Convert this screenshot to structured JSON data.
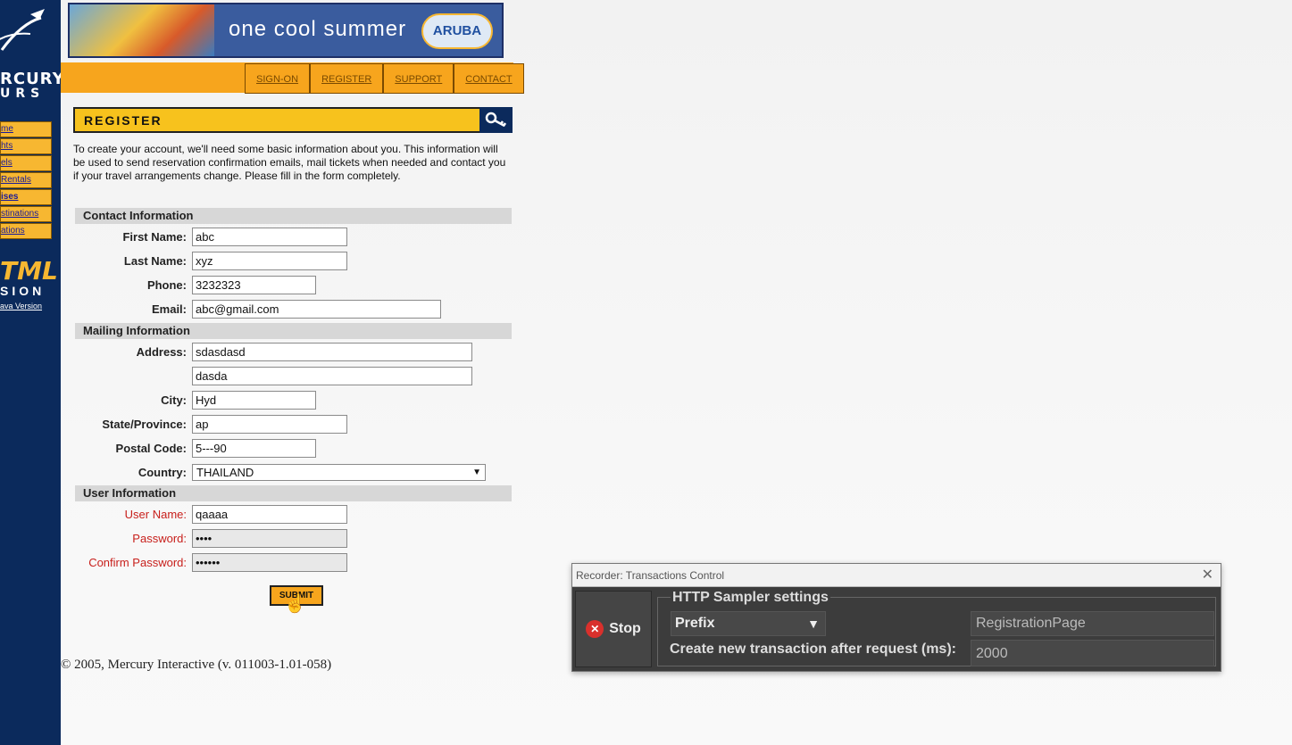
{
  "brand": {
    "logo_line1": "RCURY",
    "logo_line2": "URS"
  },
  "banner": {
    "tagline": "one cool summer",
    "badge": "ARUBA"
  },
  "top_nav": [
    "SIGN-ON",
    "REGISTER",
    "SUPPORT",
    "CONTACT"
  ],
  "side_nav": [
    "me",
    "hts",
    "els",
    "Rentals",
    "ises",
    "stinations",
    "ations"
  ],
  "html_version": {
    "big": "TML",
    "small": "SION",
    "java_link": "ava Version"
  },
  "page": {
    "header": "REGISTER",
    "intro": "To create your account, we'll need some basic information about you. This information will be used to send reservation confirmation emails, mail tickets when needed and contact you if your travel arrangements change. Please fill in the form completely."
  },
  "form": {
    "contact_section": "Contact Information",
    "first_name_label": "First Name:",
    "first_name": "abc",
    "last_name_label": "Last Name:",
    "last_name": "xyz",
    "phone_label": "Phone:",
    "phone": "3232323",
    "email_label": "Email:",
    "email": "abc@gmail.com",
    "mailing_section": "Mailing Information",
    "address_label": "Address:",
    "address1": "sdasdasd",
    "address2": "dasda",
    "city_label": "City:",
    "city": "Hyd",
    "state_label": "State/Province:",
    "state": "ap",
    "postal_label": "Postal Code:",
    "postal": "5---90",
    "country_label": "Country:",
    "country": "THAILAND",
    "user_section": "User Information",
    "username_label": "User Name:",
    "username": "qaaaa",
    "password_label": "Password:",
    "password": "••••",
    "confirm_label": "Confirm Password:",
    "confirm": "••••••",
    "submit": "SUBMIT"
  },
  "footer": "© 2005, Mercury Interactive (v. 011003-1.01-058)",
  "recorder": {
    "title": "Recorder: Transactions Control",
    "stop_label": "Stop",
    "group_title": "HTTP Sampler settings",
    "naming_mode": "Prefix",
    "transaction_name": "RegistrationPage",
    "delay_label": "Create new transaction after request (ms):",
    "delay_value": "2000"
  }
}
